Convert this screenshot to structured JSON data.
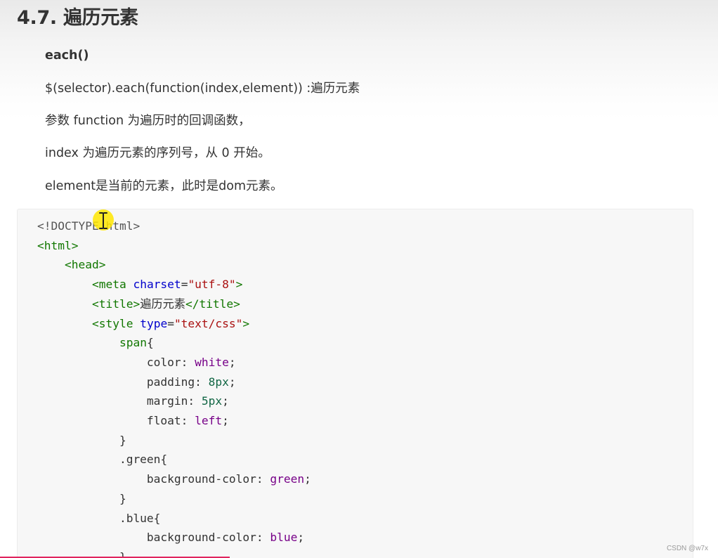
{
  "section": {
    "heading": "4.7. 遍历元素",
    "paragraphs": [
      "each()",
      "$(selector).each(function(index,element)) :遍历元素",
      "参数 function 为遍历时的回调函数，",
      "index 为遍历元素的序列号，从 0 开始。",
      "element是当前的元素，此时是dom元素。"
    ]
  },
  "code": {
    "lines": [
      [
        {
          "t": "doctype",
          "v": "<!DOCTYPE html>"
        }
      ],
      [
        {
          "t": "tag",
          "v": "<html>"
        }
      ],
      [
        {
          "t": "pun",
          "v": "    "
        },
        {
          "t": "tag",
          "v": "<head>"
        }
      ],
      [
        {
          "t": "pun",
          "v": "        "
        },
        {
          "t": "tag",
          "v": "<meta "
        },
        {
          "t": "attr",
          "v": "charset"
        },
        {
          "t": "pun",
          "v": "="
        },
        {
          "t": "str",
          "v": "\"utf-8\""
        },
        {
          "t": "tag",
          "v": ">"
        }
      ],
      [
        {
          "t": "pun",
          "v": "        "
        },
        {
          "t": "tag",
          "v": "<title>"
        },
        {
          "t": "pun",
          "v": "遍历元素"
        },
        {
          "t": "tag",
          "v": "</title>"
        }
      ],
      [
        {
          "t": "pun",
          "v": "        "
        },
        {
          "t": "tag",
          "v": "<style "
        },
        {
          "t": "attr",
          "v": "type"
        },
        {
          "t": "pun",
          "v": "="
        },
        {
          "t": "str",
          "v": "\"text/css\""
        },
        {
          "t": "tag",
          "v": ">"
        }
      ],
      [
        {
          "t": "pun",
          "v": "            "
        },
        {
          "t": "tag",
          "v": "span"
        },
        {
          "t": "pun",
          "v": "{"
        }
      ],
      [
        {
          "t": "pun",
          "v": "                color: "
        },
        {
          "t": "val",
          "v": "white"
        },
        {
          "t": "pun",
          "v": ";"
        }
      ],
      [
        {
          "t": "pun",
          "v": "                padding: "
        },
        {
          "t": "num",
          "v": "8px"
        },
        {
          "t": "pun",
          "v": ";"
        }
      ],
      [
        {
          "t": "pun",
          "v": "                margin: "
        },
        {
          "t": "num",
          "v": "5px"
        },
        {
          "t": "pun",
          "v": ";"
        }
      ],
      [
        {
          "t": "pun",
          "v": "                float: "
        },
        {
          "t": "val",
          "v": "left"
        },
        {
          "t": "pun",
          "v": ";"
        }
      ],
      [
        {
          "t": "pun",
          "v": "            }"
        }
      ],
      [
        {
          "t": "pun",
          "v": "            .green{"
        }
      ],
      [
        {
          "t": "pun",
          "v": "                background-color: "
        },
        {
          "t": "val",
          "v": "green"
        },
        {
          "t": "pun",
          "v": ";"
        }
      ],
      [
        {
          "t": "pun",
          "v": "            }"
        }
      ],
      [
        {
          "t": "pun",
          "v": "            .blue{"
        }
      ],
      [
        {
          "t": "pun",
          "v": "                background-color: "
        },
        {
          "t": "val",
          "v": "blue"
        },
        {
          "t": "pun",
          "v": ";"
        }
      ],
      [
        {
          "t": "pun",
          "v": "            }"
        }
      ]
    ]
  },
  "watermark": "CSDN @w7x",
  "video_progress": 0.32,
  "colors": {
    "tag": "#117700",
    "attr": "#0000cc",
    "string": "#aa1111",
    "keyword_value": "#770088",
    "number": "#116644",
    "progress": "#e0245e",
    "cursor_highlight": "#ffe600"
  },
  "icons": {
    "cursor": "ibeam-icon"
  }
}
